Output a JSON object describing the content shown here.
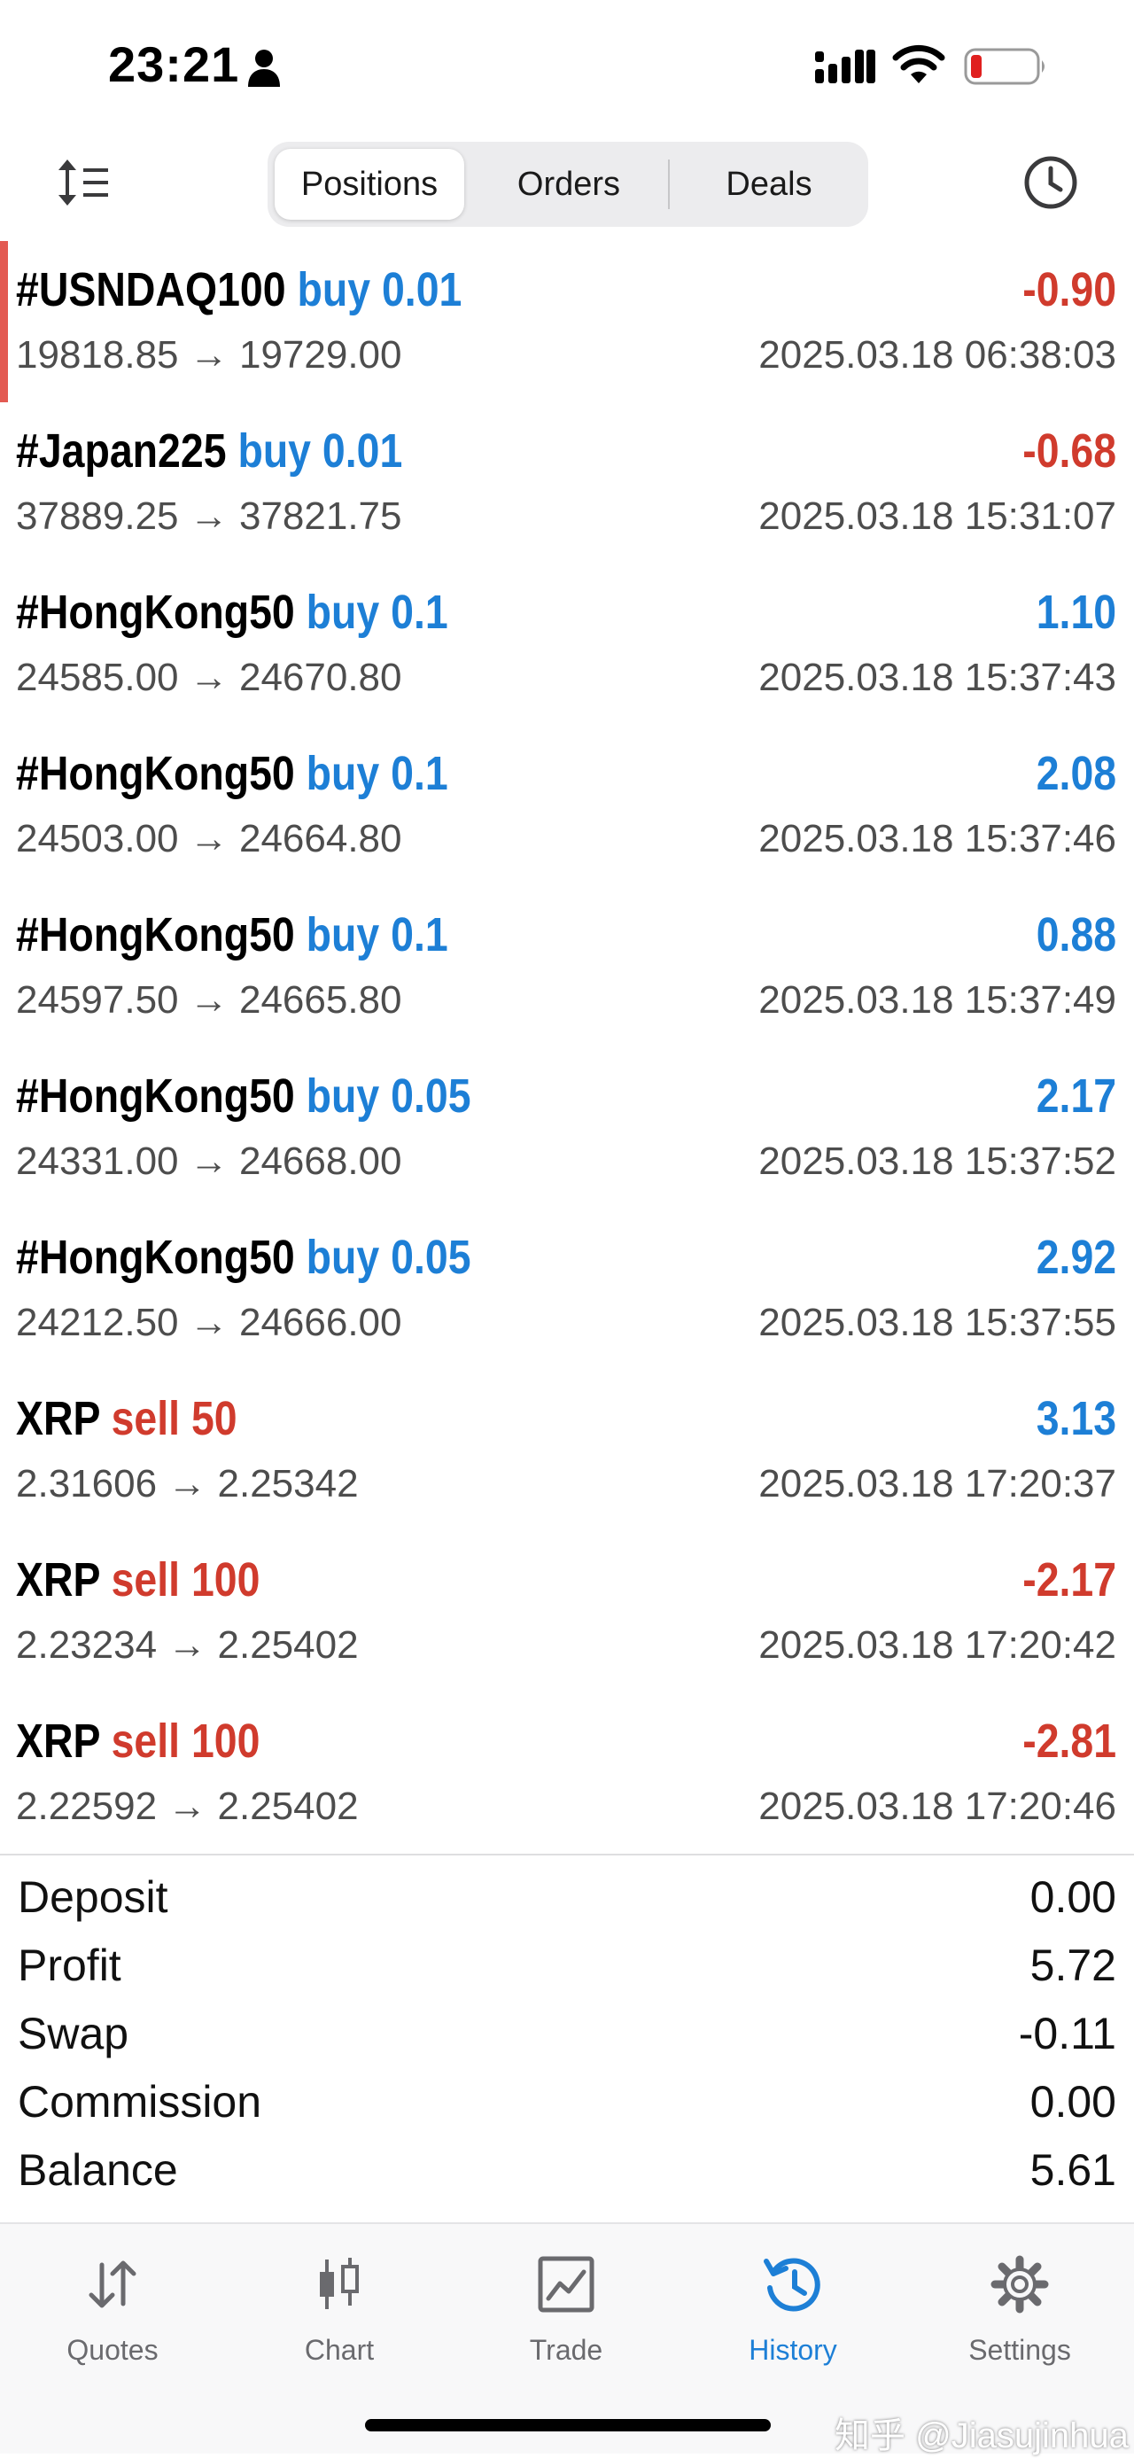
{
  "status_bar": {
    "time": "23:21"
  },
  "toolbar": {
    "tabs": [
      {
        "label": "Positions",
        "active": true
      },
      {
        "label": "Orders",
        "active": false
      },
      {
        "label": "Deals",
        "active": false
      }
    ]
  },
  "deals": [
    {
      "symbol": "#USNDAQ100",
      "side": "buy",
      "volume": "0.01",
      "prices": "19818.85 → 19729.00",
      "time": "2025.03.18 06:38:03",
      "profit": "-0.90"
    },
    {
      "symbol": "#Japan225",
      "side": "buy",
      "volume": "0.01",
      "prices": "37889.25 → 37821.75",
      "time": "2025.03.18 15:31:07",
      "profit": "-0.68"
    },
    {
      "symbol": "#HongKong50",
      "side": "buy",
      "volume": "0.1",
      "prices": "24585.00 → 24670.80",
      "time": "2025.03.18 15:37:43",
      "profit": "1.10"
    },
    {
      "symbol": "#HongKong50",
      "side": "buy",
      "volume": "0.1",
      "prices": "24503.00 → 24664.80",
      "time": "2025.03.18 15:37:46",
      "profit": "2.08"
    },
    {
      "symbol": "#HongKong50",
      "side": "buy",
      "volume": "0.1",
      "prices": "24597.50 → 24665.80",
      "time": "2025.03.18 15:37:49",
      "profit": "0.88"
    },
    {
      "symbol": "#HongKong50",
      "side": "buy",
      "volume": "0.05",
      "prices": "24331.00 → 24668.00",
      "time": "2025.03.18 15:37:52",
      "profit": "2.17"
    },
    {
      "symbol": "#HongKong50",
      "side": "buy",
      "volume": "0.05",
      "prices": "24212.50 → 24666.00",
      "time": "2025.03.18 15:37:55",
      "profit": "2.92"
    },
    {
      "symbol": "XRP",
      "side": "sell",
      "volume": "50",
      "prices": "2.31606 → 2.25342",
      "time": "2025.03.18 17:20:37",
      "profit": "3.13"
    },
    {
      "symbol": "XRP",
      "side": "sell",
      "volume": "100",
      "prices": "2.23234 → 2.25402",
      "time": "2025.03.18 17:20:42",
      "profit": "-2.17"
    },
    {
      "symbol": "XRP",
      "side": "sell",
      "volume": "100",
      "prices": "2.22592 → 2.25402",
      "time": "2025.03.18 17:20:46",
      "profit": "-2.81"
    }
  ],
  "summary": [
    {
      "label": "Deposit",
      "value": "0.00"
    },
    {
      "label": "Profit",
      "value": "5.72"
    },
    {
      "label": "Swap",
      "value": "-0.11"
    },
    {
      "label": "Commission",
      "value": "0.00"
    },
    {
      "label": "Balance",
      "value": "5.61"
    }
  ],
  "tabbar": {
    "items": [
      {
        "label": "Quotes",
        "icon": "quotes-arrows-icon"
      },
      {
        "label": "Chart",
        "icon": "candlestick-icon"
      },
      {
        "label": "Trade",
        "icon": "trade-chart-icon"
      },
      {
        "label": "History",
        "icon": "history-clock-icon",
        "active": true
      },
      {
        "label": "Settings",
        "icon": "gear-icon"
      }
    ]
  },
  "watermark": "知乎 @Jiasujinhua",
  "colors": {
    "buy": "#1d7fd6",
    "sell": "#d03b2d",
    "accent": "#1d7fd6",
    "selected_bar": "#e35a52"
  }
}
